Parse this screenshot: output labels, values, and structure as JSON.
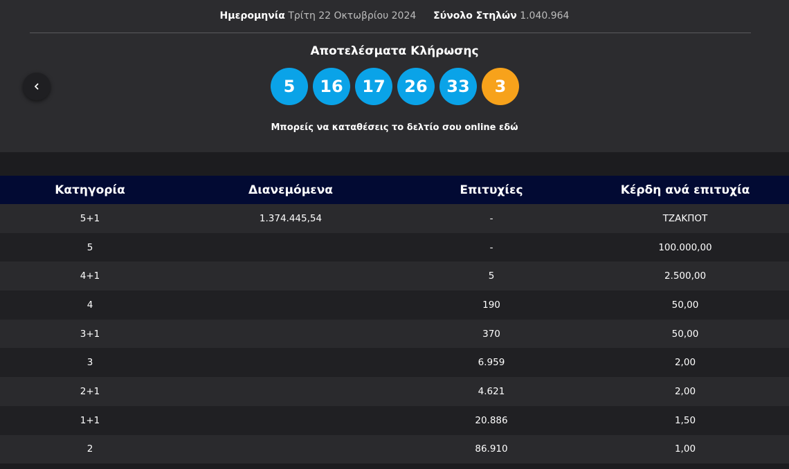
{
  "header": {
    "date_label": "Ημερομηνία",
    "date_value": "Τρίτη 22 Οκτωβρίου 2024",
    "columns_label": "Σύνολο Στηλών",
    "columns_value": "1.040.964"
  },
  "draw": {
    "title": "Αποτελέσματα Κλήρωσης",
    "numbers": [
      "5",
      "16",
      "17",
      "26",
      "33"
    ],
    "bonus": "3",
    "online_text": "Μπορείς να καταθέσεις το δελτίο σου online εδώ"
  },
  "icons": {
    "prev": "chevron-left-icon"
  },
  "colors": {
    "ball": "#0aa3e8",
    "bonus_ball": "#f7a21b",
    "table_header": "#020a33"
  },
  "table": {
    "headers": [
      "Κατηγορία",
      "Διανεμόμενα",
      "Επιτυχίες",
      "Κέρδη ανά επιτυχία"
    ],
    "rows": [
      [
        "5+1",
        "1.374.445,54",
        "-",
        "ΤΖΑΚΠΟΤ"
      ],
      [
        "5",
        "",
        "-",
        "100.000,00"
      ],
      [
        "4+1",
        "",
        "5",
        "2.500,00"
      ],
      [
        "4",
        "",
        "190",
        "50,00"
      ],
      [
        "3+1",
        "",
        "370",
        "50,00"
      ],
      [
        "3",
        "",
        "6.959",
        "2,00"
      ],
      [
        "2+1",
        "",
        "4.621",
        "2,00"
      ],
      [
        "1+1",
        "",
        "20.886",
        "1,50"
      ],
      [
        "2",
        "",
        "86.910",
        "1,00"
      ]
    ]
  }
}
